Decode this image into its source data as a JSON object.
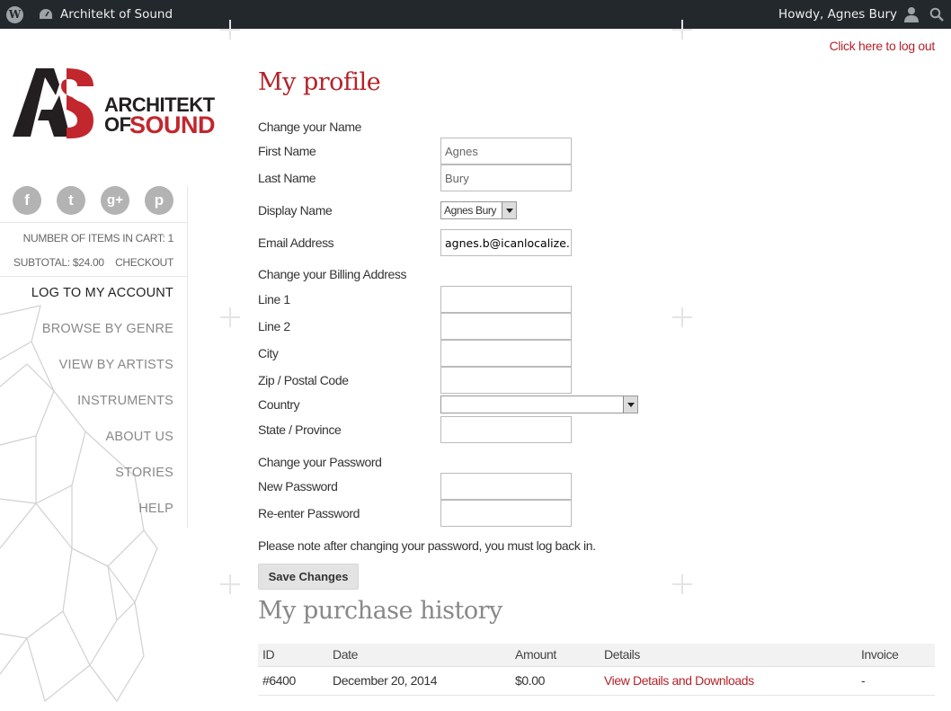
{
  "adminbar": {
    "site_name": "Architekt of Sound",
    "greeting": "Howdy, Agnes Bury"
  },
  "logout_link": "Click here to log out",
  "logo": {
    "line1": "ARCHITEKT",
    "line2a": "OF",
    "line2b": "SOUND",
    "mark_left": "A",
    "mark_right": "S"
  },
  "social": {
    "facebook": "f",
    "twitter": "t",
    "googleplus": "g+",
    "pinterest": "p"
  },
  "cart": {
    "items_label": "NUMBER OF ITEMS IN CART: 1",
    "subtotal_label": "SUBTOTAL: $24.00",
    "checkout_label": "CHECKOUT"
  },
  "nav": [
    "LOG TO MY ACCOUNT",
    "BROWSE BY GENRE",
    "VIEW BY ARTISTS",
    "INSTRUMENTS",
    "ABOUT US",
    "STORIES",
    "HELP"
  ],
  "profile": {
    "title": "My profile",
    "section_name": "Change your Name",
    "first_name_label": "First Name",
    "first_name_value": "Agnes",
    "last_name_label": "Last Name",
    "last_name_value": "Bury",
    "display_name_label": "Display Name",
    "display_name_value": "Agnes Bury",
    "email_label": "Email Address",
    "email_value": "agnes.b@icanlocalize.",
    "section_billing": "Change your Billing Address",
    "line1_label": "Line 1",
    "line2_label": "Line 2",
    "city_label": "City",
    "zip_label": "Zip / Postal Code",
    "country_label": "Country",
    "state_label": "State / Province",
    "section_password": "Change your Password",
    "new_password_label": "New Password",
    "reenter_password_label": "Re-enter Password",
    "password_note": "Please note after changing your password, you must log back in.",
    "save_button": "Save Changes"
  },
  "history": {
    "title": "My purchase history",
    "columns": [
      "ID",
      "Date",
      "Amount",
      "Details",
      "Invoice"
    ],
    "rows": [
      [
        "#6400",
        "December 20, 2014",
        "$0.00",
        "View Details and Downloads",
        "-"
      ]
    ]
  },
  "colors": {
    "accent": "#b5232a",
    "adminbar": "#23282d",
    "nav_text": "#888888"
  }
}
